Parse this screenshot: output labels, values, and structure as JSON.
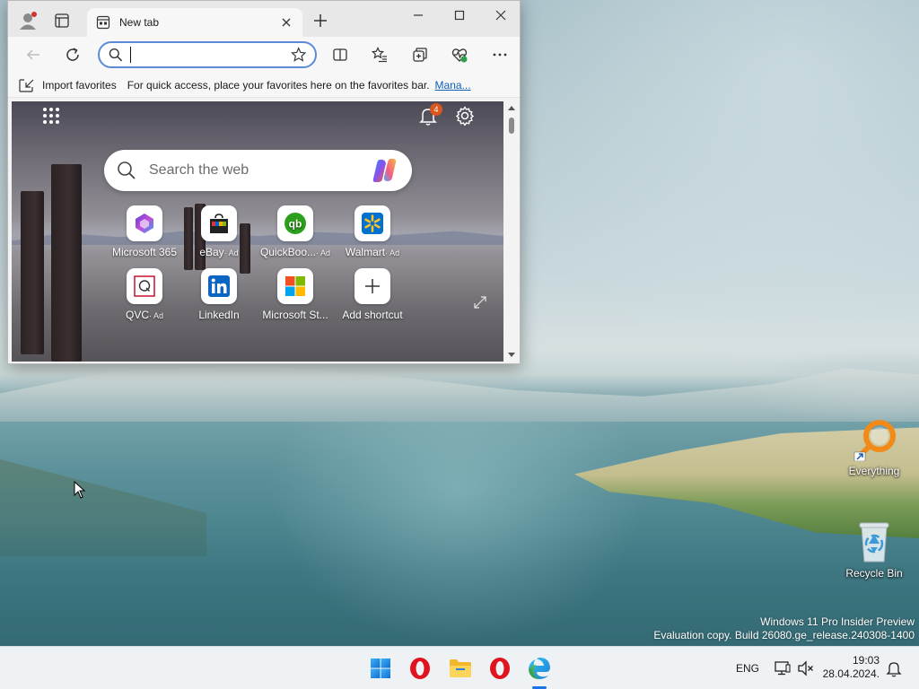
{
  "browser": {
    "tab_title": "New tab",
    "address_value": "",
    "favorites_bar": {
      "import_label": "Import favorites",
      "hint": "For quick access, place your favorites here on the favorites bar.",
      "manage_link": "Mana..."
    },
    "ntp": {
      "notification_count": "4",
      "search_placeholder": "Search the web",
      "tiles": [
        {
          "label": "Microsoft 365",
          "ad": ""
        },
        {
          "label": "eBay",
          "ad": "· Ad"
        },
        {
          "label": "QuickBoo...",
          "ad": "· Ad"
        },
        {
          "label": "Walmart",
          "ad": "· Ad"
        },
        {
          "label": "QVC",
          "ad": "· Ad"
        },
        {
          "label": "LinkedIn",
          "ad": ""
        },
        {
          "label": "Microsoft St...",
          "ad": ""
        },
        {
          "label": "Add shortcut",
          "ad": ""
        }
      ]
    }
  },
  "desktop": {
    "icons": [
      {
        "label": "Everything"
      },
      {
        "label": "Recycle Bin"
      }
    ],
    "watermark": {
      "line1": "Windows 11 Pro Insider Preview",
      "line2": "Evaluation copy. Build 26080.ge_release.240308-1400"
    }
  },
  "taskbar": {
    "language": "ENG",
    "time": "19:03",
    "date": "28.04.2024."
  },
  "colors": {
    "accent": "#1a73e8",
    "link": "#0f5fb8",
    "address_border": "#5b8bd6",
    "badge": "#d9561f"
  }
}
